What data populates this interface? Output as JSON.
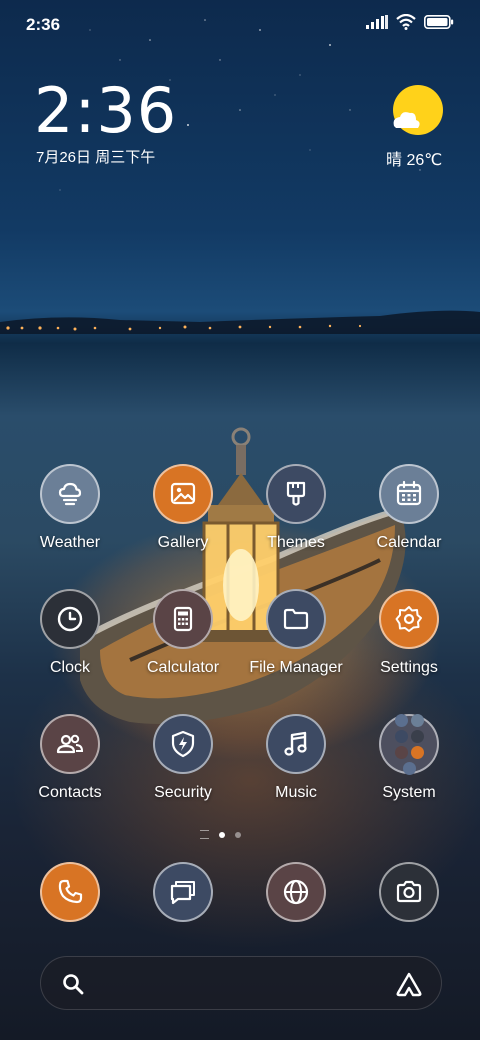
{
  "status_bar": {
    "time": "2:36"
  },
  "clock_widget": {
    "time": "2:36",
    "date": "7月26日 周三下午"
  },
  "weather_widget": {
    "text": "晴 26℃"
  },
  "apps": [
    {
      "label": "Weather"
    },
    {
      "label": "Gallery"
    },
    {
      "label": "Themes"
    },
    {
      "label": "Calendar"
    },
    {
      "label": "Clock"
    },
    {
      "label": "Calculator"
    },
    {
      "label": "File Manager"
    },
    {
      "label": "Settings"
    },
    {
      "label": "Contacts"
    },
    {
      "label": "Security"
    },
    {
      "label": "Music"
    },
    {
      "label": "System"
    }
  ],
  "dock": [
    "phone-icon",
    "messages-icon",
    "browser-icon",
    "camera-icon"
  ],
  "colors": {
    "accent_orange": "#d87424",
    "blue_gray": "#6b7f97",
    "navy": "#3d4a63",
    "sun": "#ffd21a"
  }
}
